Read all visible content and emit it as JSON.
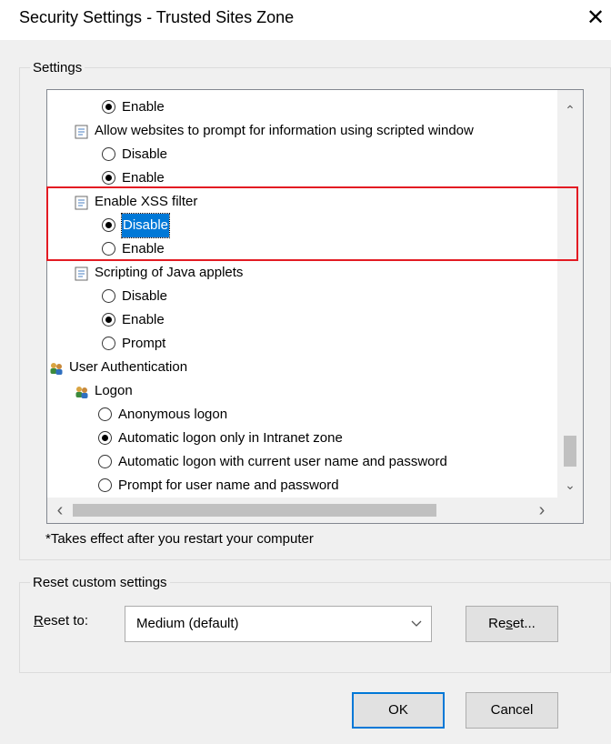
{
  "window": {
    "title": "Security Settings - Trusted Sites Zone",
    "close_glyph": "✕"
  },
  "settings_group": {
    "label": "Settings"
  },
  "tree": {
    "rows": [
      {
        "kind": "radio",
        "text": "Enable",
        "checked": true
      },
      {
        "kind": "setting",
        "text": "Allow websites to prompt for information using scripted window"
      },
      {
        "kind": "radio",
        "text": "Disable",
        "checked": false
      },
      {
        "kind": "radio",
        "text": "Enable",
        "checked": true
      },
      {
        "kind": "setting",
        "text": "Enable XSS filter"
      },
      {
        "kind": "radio",
        "text": "Disable",
        "checked": true,
        "selected": true
      },
      {
        "kind": "radio",
        "text": "Enable",
        "checked": false
      },
      {
        "kind": "setting",
        "text": "Scripting of Java applets"
      },
      {
        "kind": "radio",
        "text": "Disable",
        "checked": false
      },
      {
        "kind": "radio",
        "text": "Enable",
        "checked": true
      },
      {
        "kind": "radio",
        "text": "Prompt",
        "checked": false
      },
      {
        "kind": "category",
        "text": "User Authentication"
      },
      {
        "kind": "subcategory",
        "text": "Logon"
      },
      {
        "kind": "radio2",
        "text": "Anonymous logon",
        "checked": false
      },
      {
        "kind": "radio2",
        "text": "Automatic logon only in Intranet zone",
        "checked": true
      },
      {
        "kind": "radio2",
        "text": "Automatic logon with current user name and password",
        "checked": false
      },
      {
        "kind": "radio2",
        "text": "Prompt for user name and password",
        "checked": false
      }
    ],
    "scroll_arrows": {
      "up": "⌃",
      "down": "⌄",
      "left": "‹",
      "right": "›"
    }
  },
  "note": "*Takes effect after you restart your computer",
  "reset_group": {
    "label": "Reset custom settings",
    "reset_to_label": "Reset to:",
    "reset_to_value": "Medium (default)",
    "reset_button": "Reset..."
  },
  "buttons": {
    "ok": "OK",
    "cancel": "Cancel"
  },
  "colors": {
    "selection": "#0078d7",
    "highlight_box": "#e31b23"
  }
}
